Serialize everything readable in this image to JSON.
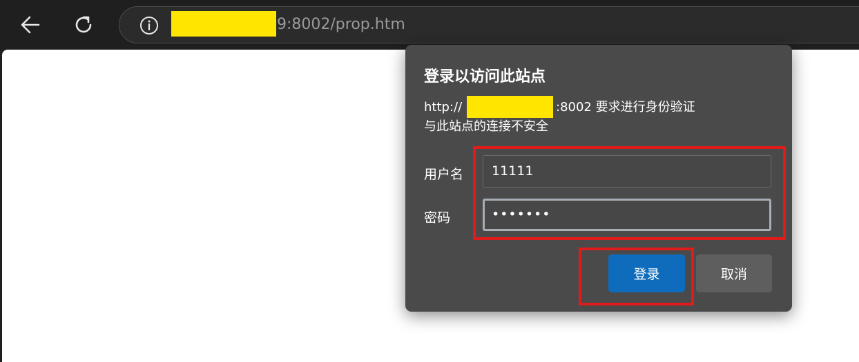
{
  "browser": {
    "url_suffix": "9:8002/prop.htm",
    "icons": {
      "back": "arrow-left-icon",
      "reload": "reload-icon",
      "site_info": "info-icon"
    }
  },
  "auth_dialog": {
    "title": "登录以访问此站点",
    "line1_prefix": "http://",
    "line1_suffix": ":8002 要求进行身份验证",
    "line2": "与此站点的连接不安全",
    "username_label": "用户名",
    "username_value": "11111",
    "password_label": "密码",
    "password_value": "•••••••",
    "login_label": "登录",
    "cancel_label": "取消"
  },
  "colors": {
    "redaction": "#ffe600",
    "highlight": "#e01b1b",
    "primary_button": "#0f6cbd",
    "dialog_bg": "#4a4a4a"
  }
}
